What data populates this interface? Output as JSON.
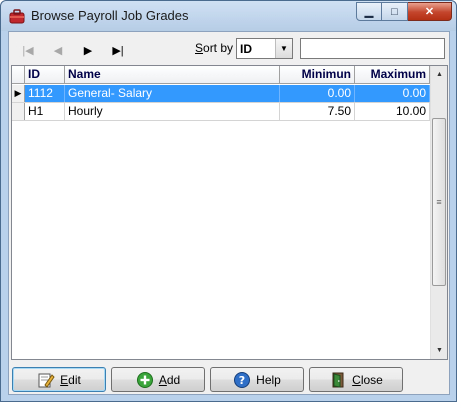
{
  "window": {
    "title": "Browse Payroll Job Grades"
  },
  "toolbar": {
    "nav": [
      "|◀",
      "◀",
      "▶",
      "▶|"
    ],
    "sort_label_prefix": "S",
    "sort_label_rest": "ort by",
    "sort_value": "ID",
    "search_value": ""
  },
  "grid": {
    "columns": [
      "ID",
      "Name",
      "Minimun",
      "Maximum"
    ],
    "rows": [
      {
        "id": "1112",
        "name": "General- Salary",
        "min": "0.00",
        "max": "0.00",
        "selected": true
      },
      {
        "id": "H1",
        "name": "Hourly",
        "min": "7.50",
        "max": "10.00",
        "selected": false
      }
    ]
  },
  "buttons": {
    "edit": {
      "u": "E",
      "rest": "dit"
    },
    "add": {
      "u": "A",
      "rest": "dd"
    },
    "help": {
      "u": "",
      "rest": "Help"
    },
    "close": {
      "u": "C",
      "rest": "lose"
    }
  },
  "colors": {
    "selection": "#3399ff",
    "header_text": "#000048",
    "frame": "#b9d1ea"
  },
  "icons": [
    "app-icon",
    "minimize-icon",
    "maximize-icon",
    "close-icon",
    "edit-icon",
    "add-icon",
    "help-icon",
    "exit-door-icon"
  ]
}
